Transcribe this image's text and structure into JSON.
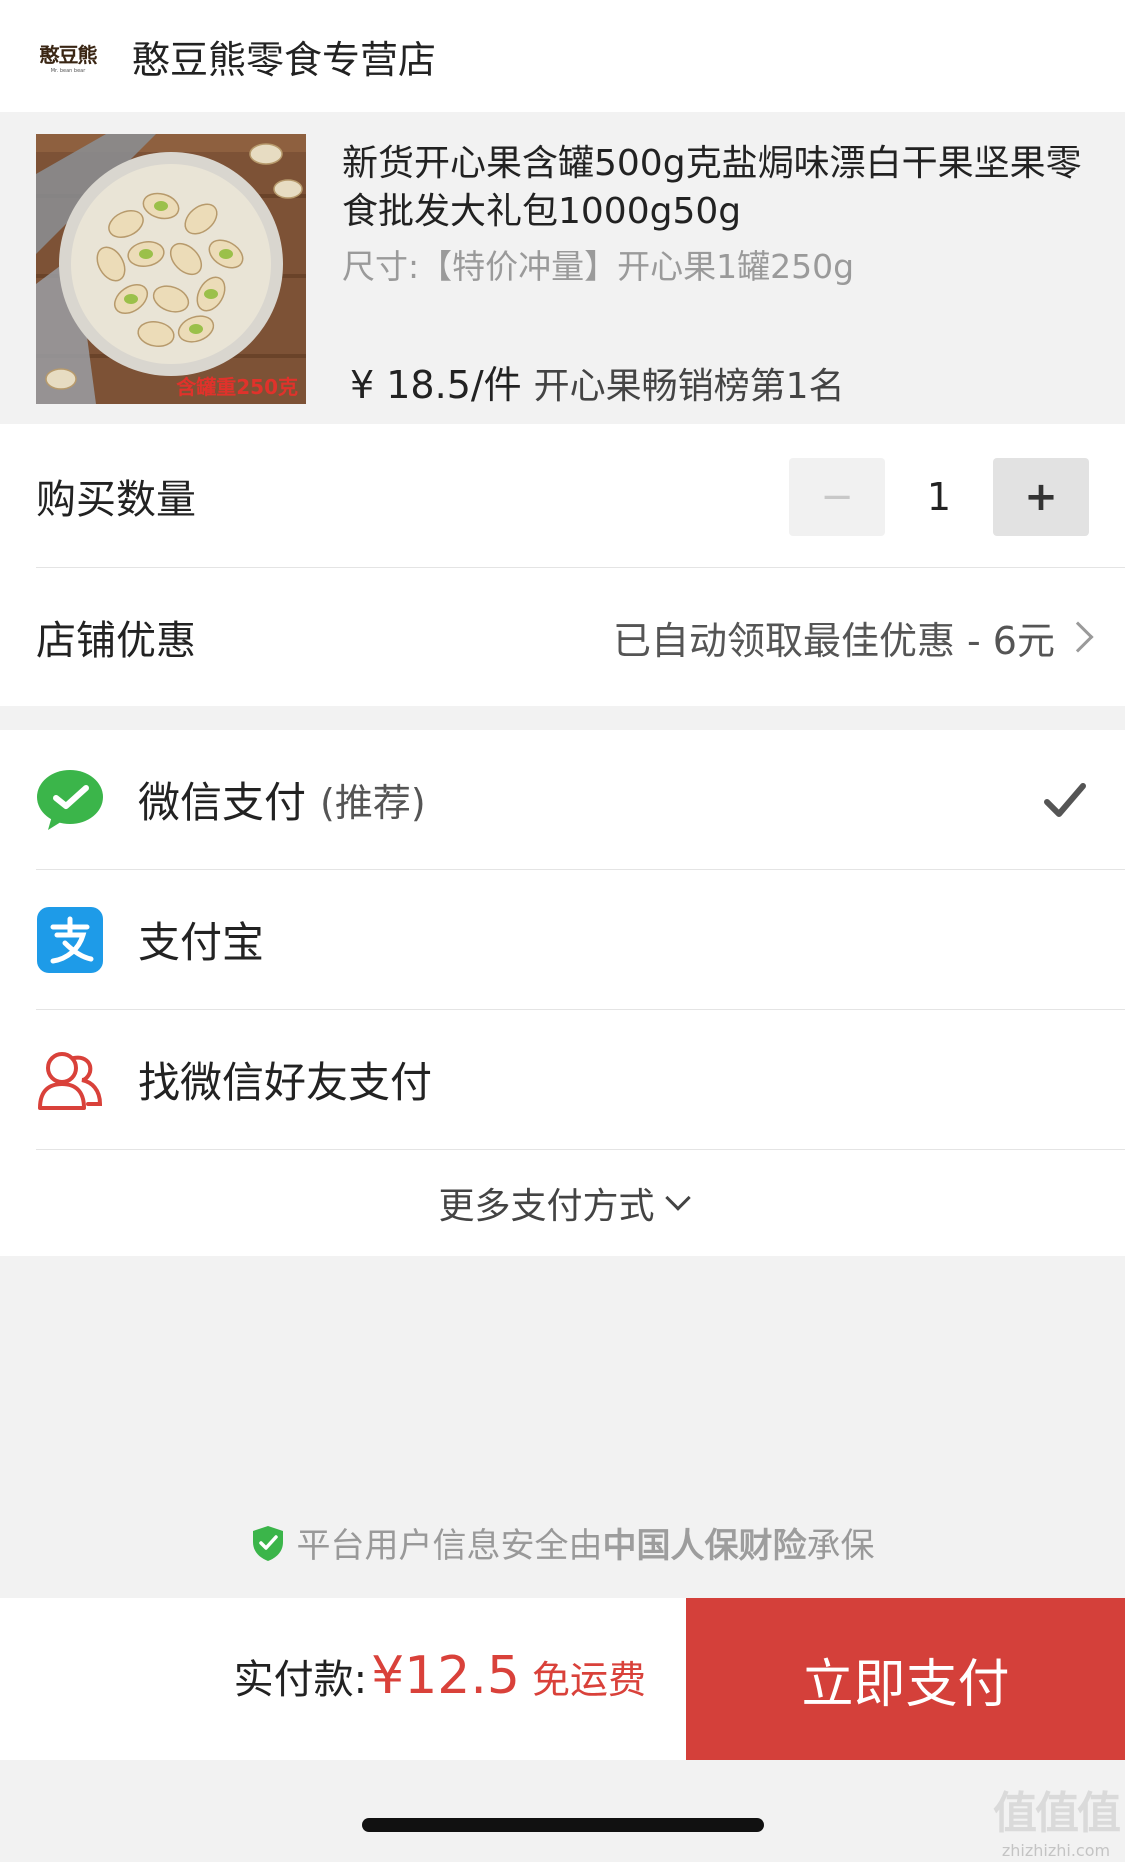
{
  "store": {
    "logo_text": "憨豆熊",
    "logo_sub": "Mr. bean bear",
    "name": "憨豆熊零食专营店"
  },
  "product": {
    "image_caption": "含罐重250克",
    "title": "新货开心果含罐500g克盐焗味漂白干果坚果零食批发大礼包1000g50g",
    "spec": "尺寸:【特价冲量】开心果1罐250g",
    "price": "¥ 18.5/件",
    "rank": "开心果畅销榜第1名"
  },
  "order": {
    "quantity_label": "购买数量",
    "minus": "−",
    "quantity": "1",
    "plus": "+",
    "discount_label": "店铺优惠",
    "discount_value": "已自动领取最佳优惠 - 6元"
  },
  "payment": {
    "wechat_label": "微信支付",
    "wechat_note": "(推荐)",
    "alipay_label": "支付宝",
    "friend_label": "找微信好友支付",
    "more_label": "更多支付方式"
  },
  "security": {
    "prefix": "平台用户信息安全由",
    "insurer": "中国人保财险",
    "suffix": "承保"
  },
  "checkout": {
    "total_label": "实付款:",
    "total_amount": "¥12.5",
    "shipping_note": "免运费",
    "pay_button": "立即支付"
  },
  "watermark": {
    "big": "值值值",
    "small": "zhizhizhi.com"
  },
  "colors": {
    "accent_red": "#d4403a",
    "wechat_green": "#3bb54a",
    "alipay_blue": "#1e9be8",
    "friend_red": "#d9413a"
  },
  "icons": {
    "wechat": "wechat-pay-icon",
    "alipay": "alipay-icon",
    "friend": "friends-icon",
    "check": "check-icon",
    "shield": "shield-check-icon"
  }
}
